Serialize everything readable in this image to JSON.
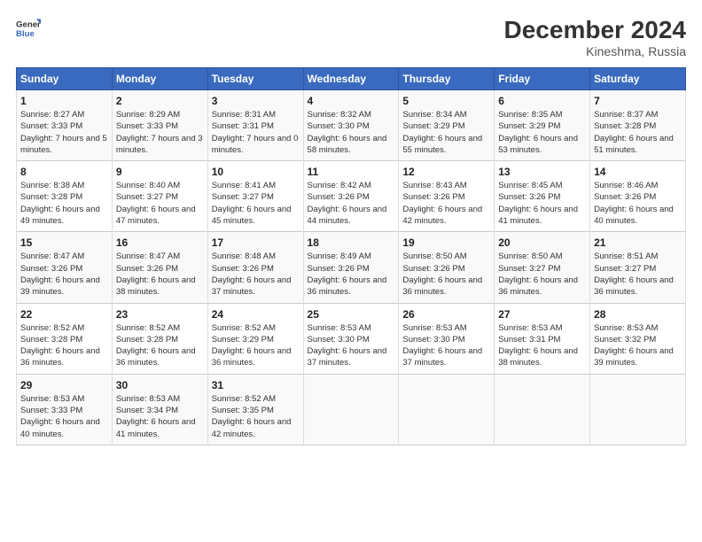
{
  "logo": {
    "line1": "General",
    "line2": "Blue"
  },
  "title": "December 2024",
  "subtitle": "Kineshma, Russia",
  "weekdays": [
    "Sunday",
    "Monday",
    "Tuesday",
    "Wednesday",
    "Thursday",
    "Friday",
    "Saturday"
  ],
  "weeks": [
    [
      {
        "day": "1",
        "sunrise": "Sunrise: 8:27 AM",
        "sunset": "Sunset: 3:33 PM",
        "daylight": "Daylight: 7 hours and 5 minutes."
      },
      {
        "day": "2",
        "sunrise": "Sunrise: 8:29 AM",
        "sunset": "Sunset: 3:33 PM",
        "daylight": "Daylight: 7 hours and 3 minutes."
      },
      {
        "day": "3",
        "sunrise": "Sunrise: 8:31 AM",
        "sunset": "Sunset: 3:31 PM",
        "daylight": "Daylight: 7 hours and 0 minutes."
      },
      {
        "day": "4",
        "sunrise": "Sunrise: 8:32 AM",
        "sunset": "Sunset: 3:30 PM",
        "daylight": "Daylight: 6 hours and 58 minutes."
      },
      {
        "day": "5",
        "sunrise": "Sunrise: 8:34 AM",
        "sunset": "Sunset: 3:29 PM",
        "daylight": "Daylight: 6 hours and 55 minutes."
      },
      {
        "day": "6",
        "sunrise": "Sunrise: 8:35 AM",
        "sunset": "Sunset: 3:29 PM",
        "daylight": "Daylight: 6 hours and 53 minutes."
      },
      {
        "day": "7",
        "sunrise": "Sunrise: 8:37 AM",
        "sunset": "Sunset: 3:28 PM",
        "daylight": "Daylight: 6 hours and 51 minutes."
      }
    ],
    [
      {
        "day": "8",
        "sunrise": "Sunrise: 8:38 AM",
        "sunset": "Sunset: 3:28 PM",
        "daylight": "Daylight: 6 hours and 49 minutes."
      },
      {
        "day": "9",
        "sunrise": "Sunrise: 8:40 AM",
        "sunset": "Sunset: 3:27 PM",
        "daylight": "Daylight: 6 hours and 47 minutes."
      },
      {
        "day": "10",
        "sunrise": "Sunrise: 8:41 AM",
        "sunset": "Sunset: 3:27 PM",
        "daylight": "Daylight: 6 hours and 45 minutes."
      },
      {
        "day": "11",
        "sunrise": "Sunrise: 8:42 AM",
        "sunset": "Sunset: 3:26 PM",
        "daylight": "Daylight: 6 hours and 44 minutes."
      },
      {
        "day": "12",
        "sunrise": "Sunrise: 8:43 AM",
        "sunset": "Sunset: 3:26 PM",
        "daylight": "Daylight: 6 hours and 42 minutes."
      },
      {
        "day": "13",
        "sunrise": "Sunrise: 8:45 AM",
        "sunset": "Sunset: 3:26 PM",
        "daylight": "Daylight: 6 hours and 41 minutes."
      },
      {
        "day": "14",
        "sunrise": "Sunrise: 8:46 AM",
        "sunset": "Sunset: 3:26 PM",
        "daylight": "Daylight: 6 hours and 40 minutes."
      }
    ],
    [
      {
        "day": "15",
        "sunrise": "Sunrise: 8:47 AM",
        "sunset": "Sunset: 3:26 PM",
        "daylight": "Daylight: 6 hours and 39 minutes."
      },
      {
        "day": "16",
        "sunrise": "Sunrise: 8:47 AM",
        "sunset": "Sunset: 3:26 PM",
        "daylight": "Daylight: 6 hours and 38 minutes."
      },
      {
        "day": "17",
        "sunrise": "Sunrise: 8:48 AM",
        "sunset": "Sunset: 3:26 PM",
        "daylight": "Daylight: 6 hours and 37 minutes."
      },
      {
        "day": "18",
        "sunrise": "Sunrise: 8:49 AM",
        "sunset": "Sunset: 3:26 PM",
        "daylight": "Daylight: 6 hours and 36 minutes."
      },
      {
        "day": "19",
        "sunrise": "Sunrise: 8:50 AM",
        "sunset": "Sunset: 3:26 PM",
        "daylight": "Daylight: 6 hours and 36 minutes."
      },
      {
        "day": "20",
        "sunrise": "Sunrise: 8:50 AM",
        "sunset": "Sunset: 3:27 PM",
        "daylight": "Daylight: 6 hours and 36 minutes."
      },
      {
        "day": "21",
        "sunrise": "Sunrise: 8:51 AM",
        "sunset": "Sunset: 3:27 PM",
        "daylight": "Daylight: 6 hours and 36 minutes."
      }
    ],
    [
      {
        "day": "22",
        "sunrise": "Sunrise: 8:52 AM",
        "sunset": "Sunset: 3:28 PM",
        "daylight": "Daylight: 6 hours and 36 minutes."
      },
      {
        "day": "23",
        "sunrise": "Sunrise: 8:52 AM",
        "sunset": "Sunset: 3:28 PM",
        "daylight": "Daylight: 6 hours and 36 minutes."
      },
      {
        "day": "24",
        "sunrise": "Sunrise: 8:52 AM",
        "sunset": "Sunset: 3:29 PM",
        "daylight": "Daylight: 6 hours and 36 minutes."
      },
      {
        "day": "25",
        "sunrise": "Sunrise: 8:53 AM",
        "sunset": "Sunset: 3:30 PM",
        "daylight": "Daylight: 6 hours and 37 minutes."
      },
      {
        "day": "26",
        "sunrise": "Sunrise: 8:53 AM",
        "sunset": "Sunset: 3:30 PM",
        "daylight": "Daylight: 6 hours and 37 minutes."
      },
      {
        "day": "27",
        "sunrise": "Sunrise: 8:53 AM",
        "sunset": "Sunset: 3:31 PM",
        "daylight": "Daylight: 6 hours and 38 minutes."
      },
      {
        "day": "28",
        "sunrise": "Sunrise: 8:53 AM",
        "sunset": "Sunset: 3:32 PM",
        "daylight": "Daylight: 6 hours and 39 minutes."
      }
    ],
    [
      {
        "day": "29",
        "sunrise": "Sunrise: 8:53 AM",
        "sunset": "Sunset: 3:33 PM",
        "daylight": "Daylight: 6 hours and 40 minutes."
      },
      {
        "day": "30",
        "sunrise": "Sunrise: 8:53 AM",
        "sunset": "Sunset: 3:34 PM",
        "daylight": "Daylight: 6 hours and 41 minutes."
      },
      {
        "day": "31",
        "sunrise": "Sunrise: 8:52 AM",
        "sunset": "Sunset: 3:35 PM",
        "daylight": "Daylight: 6 hours and 42 minutes."
      },
      null,
      null,
      null,
      null
    ]
  ]
}
